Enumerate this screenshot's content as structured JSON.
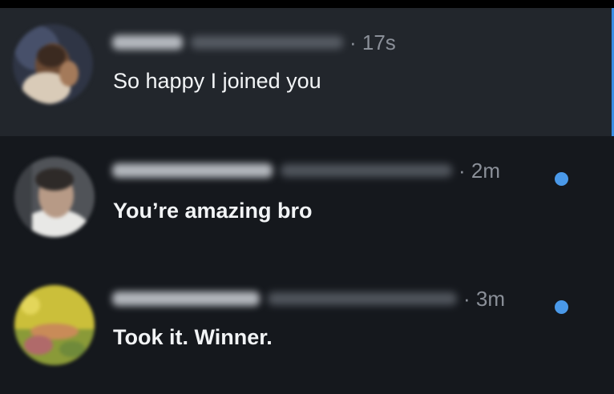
{
  "accent_color": "#4a99e9",
  "conversations": [
    {
      "time": "· 17s",
      "message": "So happy I joined you",
      "selected": true,
      "unread": false
    },
    {
      "time": "· 2m",
      "message": "You’re amazing bro",
      "selected": false,
      "unread": true
    },
    {
      "time": "· 3m",
      "message": "Took it. Winner.",
      "selected": false,
      "unread": true
    }
  ]
}
